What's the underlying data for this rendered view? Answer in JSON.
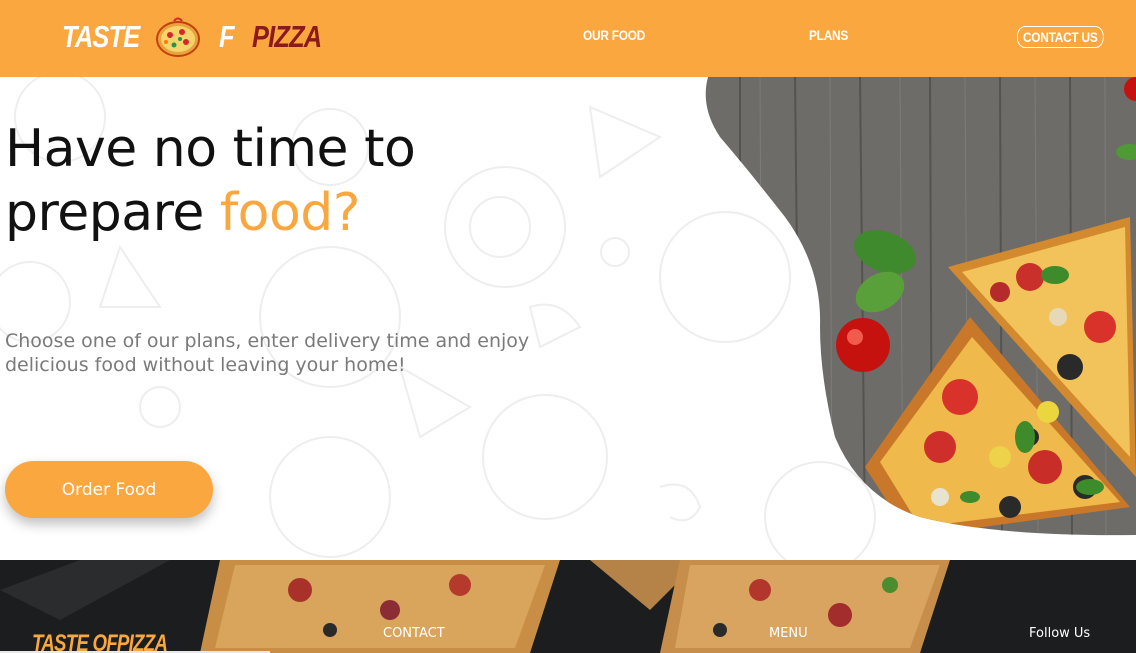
{
  "brand": {
    "logo_part1": "TASTE",
    "logo_part2": "F",
    "logo_part3": "PIZZA"
  },
  "nav": {
    "items": [
      {
        "label": "OUR FOOD"
      },
      {
        "label": "PLANS"
      },
      {
        "label": "CONTACT US"
      }
    ]
  },
  "hero": {
    "title_line1": "Have no time to",
    "title_line2_start": "prepare ",
    "title_line2_accent": "food?",
    "subtitle": "Choose one of our plans, enter delivery time and enjoy delicious food without leaving your home!",
    "cta_label": "Order Food"
  },
  "footer": {
    "logo": "TASTE OFPIZZA",
    "columns": [
      {
        "label": "CONTACT"
      },
      {
        "label": "MENU"
      },
      {
        "label": "Follow Us"
      }
    ]
  },
  "colors": {
    "accent": "#f9a73e",
    "brand_dark_red": "#8b1a1a",
    "footer_bg": "#1b1d1f"
  }
}
